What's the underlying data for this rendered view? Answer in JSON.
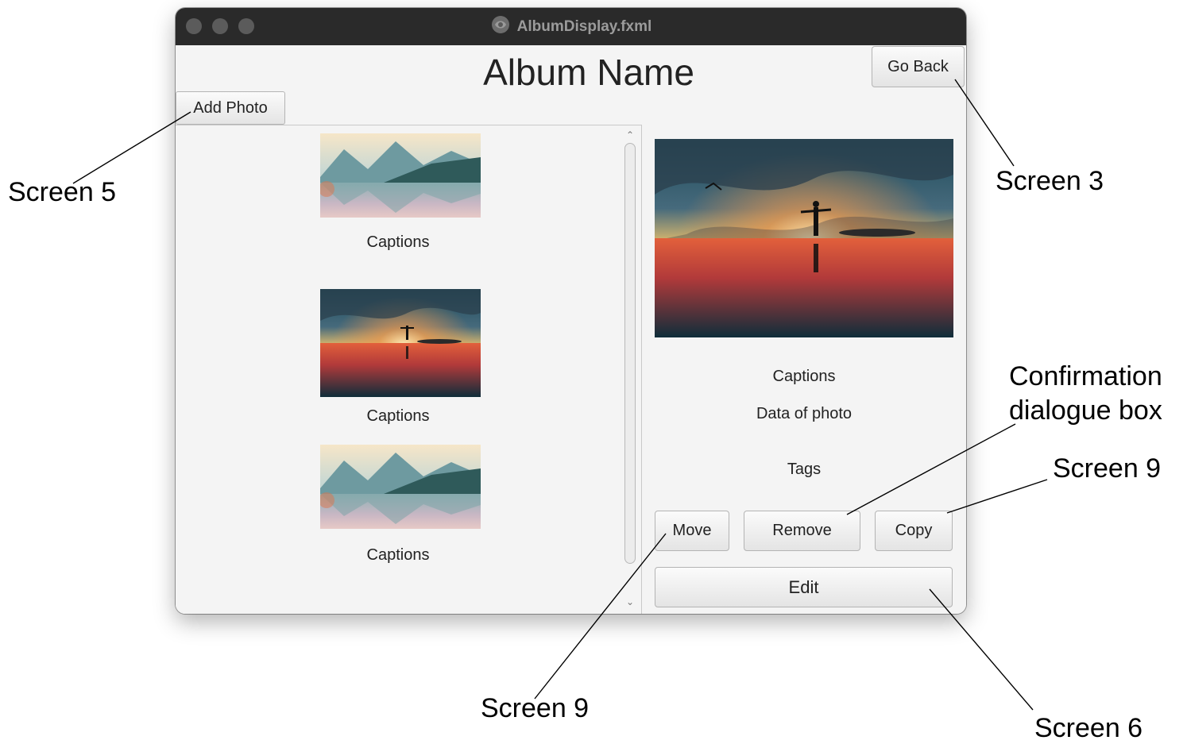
{
  "window": {
    "title": "AlbumDisplay.fxml",
    "title_icon": "javafx-app-icon",
    "traffic_lights": [
      "close-button",
      "minimize-button",
      "zoom-button"
    ]
  },
  "header": {
    "album_name": "Album Name",
    "go_back_label": "Go Back",
    "add_photo_label": "Add Photo"
  },
  "photo_list": {
    "items": [
      {
        "thumbnail": "mountain-lake-photo",
        "caption": "Captions"
      },
      {
        "thumbnail": "sunset-person-photo",
        "caption": "Captions"
      },
      {
        "thumbnail": "mountain-lake-photo",
        "caption": "Captions"
      }
    ],
    "scroll_up_icon": "chevron-up-icon",
    "scroll_down_icon": "chevron-down-icon"
  },
  "selected_photo": {
    "image": "sunset-person-photo",
    "caption": "Captions",
    "date": "Data of photo",
    "tags": "Tags"
  },
  "actions": {
    "move_label": "Move",
    "remove_label": "Remove",
    "copy_label": "Copy",
    "edit_label": "Edit"
  },
  "annotations": {
    "screen5": "Screen 5",
    "screen3": "Screen 3",
    "confirmation_line1": "Confirmation",
    "confirmation_line2": "dialogue box",
    "screen9_copy": "Screen 9",
    "screen9_move": "Screen 9",
    "screen6": "Screen 6"
  }
}
